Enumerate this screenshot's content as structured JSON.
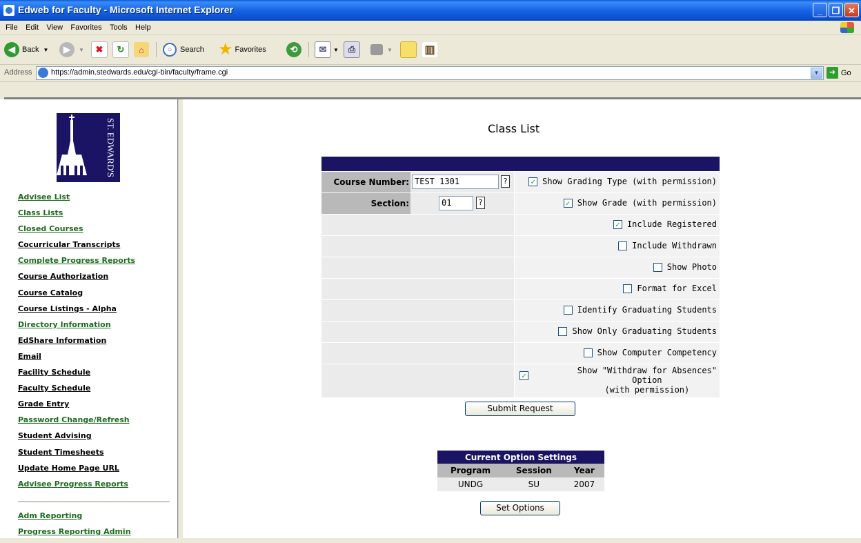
{
  "window": {
    "title": "Edweb for Faculty - Microsoft Internet Explorer"
  },
  "menu": [
    "File",
    "Edit",
    "View",
    "Favorites",
    "Tools",
    "Help"
  ],
  "toolbar": {
    "back": "Back",
    "search": "Search",
    "favorites": "Favorites"
  },
  "address": {
    "label": "Address",
    "url": "https://admin.stedwards.edu/cgi-bin/faculty/frame.cgi",
    "go": "Go"
  },
  "logo": {
    "text": "ST. EDWARD'S"
  },
  "nav": [
    {
      "label": "Advisee List",
      "style": "grn"
    },
    {
      "label": "Class Lists",
      "style": "grn"
    },
    {
      "label": "Closed Courses",
      "style": "grn"
    },
    {
      "label": "Cocurricular Transcripts",
      "style": "blk"
    },
    {
      "label": "Complete Progress Reports",
      "style": "grn"
    },
    {
      "label": "Course Authorization",
      "style": "blk"
    },
    {
      "label": "Course Catalog",
      "style": "blk"
    },
    {
      "label": "Course Listings - Alpha",
      "style": "blk"
    },
    {
      "label": "Directory Information",
      "style": "grn"
    },
    {
      "label": "EdShare Information",
      "style": "blk"
    },
    {
      "label": "Email",
      "style": "blk"
    },
    {
      "label": "Facility Schedule",
      "style": "blk"
    },
    {
      "label": "Faculty Schedule",
      "style": "blk"
    },
    {
      "label": "Grade Entry",
      "style": "blk"
    },
    {
      "label": "Password Change/Refresh",
      "style": "grn"
    },
    {
      "label": "Student Advising",
      "style": "blk"
    },
    {
      "label": "Student Timesheets",
      "style": "blk"
    },
    {
      "label": "Update Home Page URL",
      "style": "blk"
    },
    {
      "label": "Advisee Progress Reports",
      "style": "grn"
    }
  ],
  "nav2": [
    "Adm Reporting",
    "Progress Reporting Admin"
  ],
  "page": {
    "title": "Class List",
    "course_label": "Course Number:",
    "course_value": "TEST 1301",
    "section_label": "Section:",
    "section_value": "01",
    "help": "?",
    "submit": "Submit Request"
  },
  "options": [
    {
      "label": "Show Grading Type (with permission)",
      "checked": true
    },
    {
      "label": "Show Grade (with permission)",
      "checked": true
    },
    {
      "label": "Include Registered",
      "checked": true
    },
    {
      "label": "Include Withdrawn",
      "checked": false
    },
    {
      "label": "Show Photo",
      "checked": false
    },
    {
      "label": "Format for Excel",
      "checked": false
    },
    {
      "label": "Identify Graduating Students",
      "checked": false
    },
    {
      "label": "Show Only Graduating Students",
      "checked": false
    },
    {
      "label": "Show Computer Competency",
      "checked": false
    }
  ],
  "withdraw_option": {
    "line1": "Show \"Withdraw for Absences\"",
    "line2": "Option",
    "line3": "(with permission)",
    "checked": true
  },
  "settings": {
    "title": "Current Option Settings",
    "headers": [
      "Program",
      "Session",
      "Year"
    ],
    "values": [
      "UNDG",
      "SU",
      "2007"
    ],
    "button": "Set Options"
  }
}
